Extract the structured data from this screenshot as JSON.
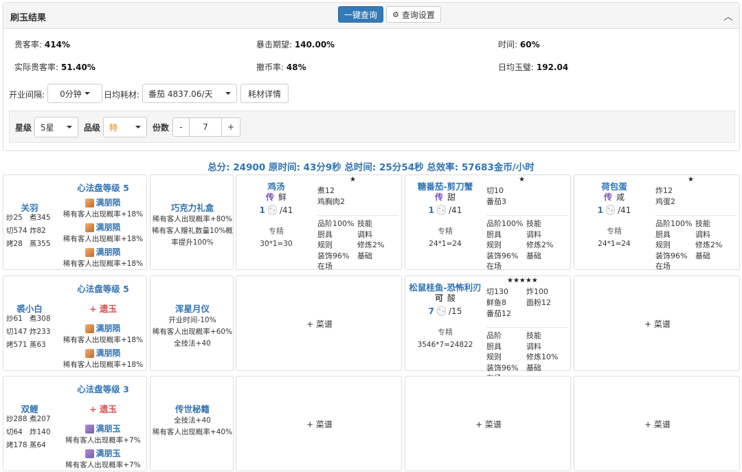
{
  "header": {
    "title": "刷玉结果",
    "query_btn": "一键查询",
    "settings_btn": "查询设置"
  },
  "stats": {
    "guest_rate_label": "贵客率:",
    "guest_rate": "414%",
    "crit_label": "暴击期望:",
    "crit": "140.00%",
    "time_label": "时间:",
    "time": "60%",
    "real_guest_label": "实际贵客率:",
    "real_guest": "51.40%",
    "coin_label": "撤币率:",
    "coin": "48%",
    "jade_label": "日均玉璧:",
    "jade": "192.04"
  },
  "controls": {
    "interval_label": "开业间隔:",
    "interval_value": "0分钟",
    "material_label": "日均耗材:",
    "material_value": "番茄 4837.06/天",
    "material_detail_btn": "耗材详情",
    "star_label": "星级",
    "star_value": "5星",
    "grade_label": "品级",
    "grade_value": "特",
    "portion_label": "份数",
    "portion_minus": "-",
    "portion_value": "7",
    "portion_plus": "+"
  },
  "summary": "总分:  24900  原时间:  43分9秒  总时间:  25分54秒  总效率:  57683金币/小时",
  "rows": [
    {
      "chef": {
        "name": "关羽",
        "s1": "炒25",
        "s2": "煮345",
        "s3": "切574",
        "s4": "炸82",
        "s5": "烤28",
        "s6": "蒸355"
      },
      "heart": {
        "title": "心法盘等级 5",
        "gems": [
          {
            "name": "满朋陨",
            "desc": "稀有客人出现概率+18%"
          },
          {
            "name": "满朋陨",
            "desc": "稀有客人出现概率+18%"
          },
          {
            "name": "满朋陨",
            "desc": "稀有客人出现概率+18%"
          }
        ]
      },
      "equip": {
        "name": "巧克力礼盒",
        "d1": "稀有客人出现概率+80%",
        "d2": "稀有客人赠礼数量10%概",
        "d3": "率提升100%"
      },
      "recipes": [
        {
          "name": "鸡汤",
          "stars": "★",
          "grade": "传",
          "taste": "鲜",
          "qty": "1",
          "max": "/41",
          "m1": "煮12",
          "m2": "鸡胸肉2",
          "m3": "",
          "m4": "",
          "m5": "",
          "m6": "",
          "proficiency": "专精",
          "calc": "30*1=30",
          "c1": "品阶100%",
          "c2": "技能",
          "c3": "厨具",
          "c4": "调料",
          "c5": "规则",
          "c6": "修炼2%",
          "c7": "装饰96%",
          "c8": "基础",
          "c9": "在场"
        },
        {
          "name": "糖番茄-剪刀蟹",
          "stars": "★",
          "grade": "传",
          "taste": "甜",
          "qty": "1",
          "max": "/41",
          "m1": "切10",
          "m2": "番茄3",
          "m3": "",
          "m4": "",
          "m5": "",
          "m6": "",
          "proficiency": "专精",
          "calc": "24*1=24",
          "c1": "品阶100%",
          "c2": "技能",
          "c3": "厨具",
          "c4": "调料",
          "c5": "规则",
          "c6": "修炼2%",
          "c7": "装饰96%",
          "c8": "基础",
          "c9": "在场"
        },
        {
          "name": "荷包蛋",
          "stars": "★",
          "grade": "传",
          "taste": "咸",
          "qty": "1",
          "max": "/41",
          "m1": "炸12",
          "m2": "鸡蛋2",
          "m3": "",
          "m4": "",
          "m5": "",
          "m6": "",
          "proficiency": "专精",
          "calc": "24*1=24",
          "c1": "品阶100%",
          "c2": "技能",
          "c3": "厨具",
          "c4": "调料",
          "c5": "规则",
          "c6": "修炼2%",
          "c7": "装饰96%",
          "c8": "基础",
          "c9": "在场"
        }
      ]
    },
    {
      "chef": {
        "name": "裘小白",
        "s1": "炒61",
        "s2": "煮308",
        "s3": "切147",
        "s4": "炸233",
        "s5": "烤571",
        "s6": "蒸63"
      },
      "heart": {
        "title": "心法盘等级 5",
        "extra": "+ 遗玉",
        "gems": [
          {
            "name": "满朋陨",
            "desc": "稀有客人出现概率+18%"
          },
          {
            "name": "满朋陨",
            "desc": "稀有客人出现概率+18%"
          }
        ]
      },
      "equip": {
        "name": "浑星月仪",
        "d1": "开业时间-10%",
        "d2": "稀有客人出现概率+60%",
        "d3": "全技法+40"
      },
      "recipes": [
        {
          "add": "+ 菜谱"
        },
        {
          "name": "松鼠桂鱼-恐怖利刃",
          "stars": "★★★★★",
          "grade": "可",
          "taste": "酸",
          "qty": "7",
          "max": "/15",
          "m1": "切130",
          "m2": "炸100",
          "m3": "鲜鱼8",
          "m4": "面粉12",
          "m5": "番茄12",
          "m6": "",
          "proficiency": "专精",
          "calc": "3546*7=24822",
          "c1": "品阶",
          "c2": "技能",
          "c3": "厨具",
          "c4": "调料",
          "c5": "规则",
          "c6": "修炼10%",
          "c7": "装饰96%",
          "c8": "基础",
          "c9": "在场"
        },
        {
          "add": "+ 菜谱"
        }
      ]
    },
    {
      "chef": {
        "name": "双鲤",
        "s1": "炒288",
        "s2": "煮207",
        "s3": "切64",
        "s4": "炸140",
        "s5": "烤178",
        "s6": "蒸64"
      },
      "heart": {
        "title": "心法盘等级 3",
        "extra": "+ 遗玉",
        "gems": [
          {
            "name": "满朋玉",
            "desc": "稀有客人出现概率+7%"
          },
          {
            "name": "满朋玉",
            "desc": "稀有客人出现概率+7%"
          }
        ]
      },
      "equip": {
        "name": "传世秘籍",
        "d1": "全技法+40",
        "d2": "稀有客人出现概率+40%",
        "d3": ""
      },
      "recipes": [
        {
          "add": "+ 菜谱"
        },
        {
          "add": "+ 菜谱"
        },
        {
          "add": "+ 菜谱"
        }
      ]
    }
  ]
}
